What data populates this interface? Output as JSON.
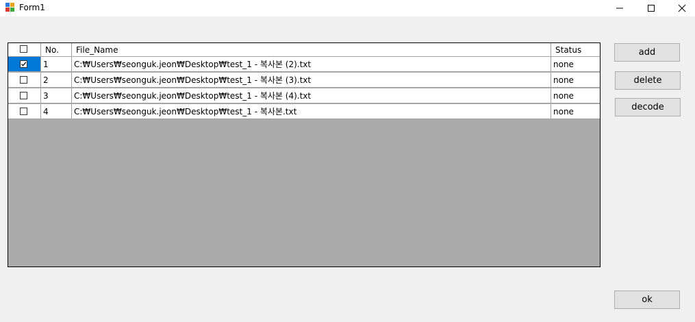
{
  "window": {
    "title": "Form1"
  },
  "grid": {
    "columns": [
      "No.",
      "File_Name",
      "Status"
    ],
    "rows": [
      {
        "checked": true,
        "no": "1",
        "file_name": "C:₩Users₩seonguk.jeon₩Desktop₩test_1 - 복사본 (2).txt",
        "status": "none"
      },
      {
        "checked": false,
        "no": "2",
        "file_name": "C:₩Users₩seonguk.jeon₩Desktop₩test_1 - 복사본 (3).txt",
        "status": "none"
      },
      {
        "checked": false,
        "no": "3",
        "file_name": "C:₩Users₩seonguk.jeon₩Desktop₩test_1 - 복사본 (4).txt",
        "status": "none"
      },
      {
        "checked": false,
        "no": "4",
        "file_name": "C:₩Users₩seonguk.jeon₩Desktop₩test_1 - 복사본.txt",
        "status": "none"
      }
    ]
  },
  "buttons": {
    "add": "add",
    "delete": "delete",
    "decode": "decode",
    "ok": "ok"
  },
  "colors": {
    "selection": "#0078d7",
    "grid_background": "#ababab",
    "form_background": "#f0f0f0"
  }
}
